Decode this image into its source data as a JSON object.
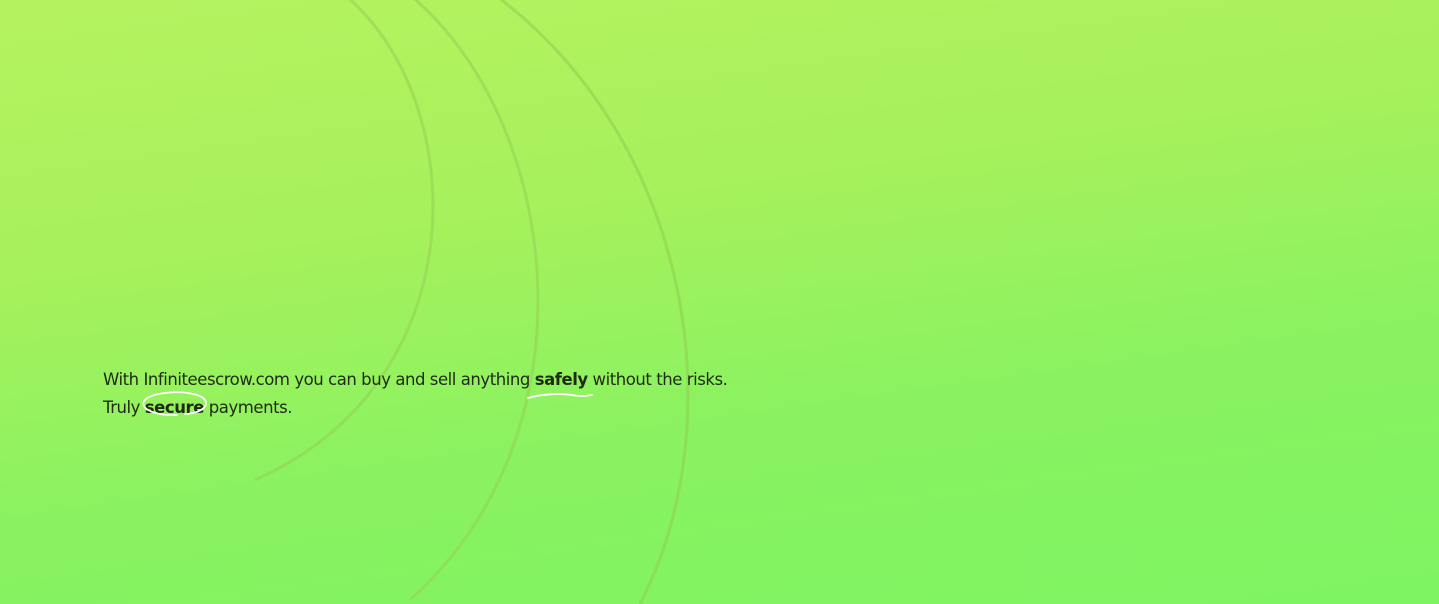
{
  "hero": {
    "line1_before": "With Infiniteescrow.com you can buy and sell anything ",
    "line1_highlight": "safely",
    "line1_after": " without the risks.",
    "line2_before": "Truly ",
    "line2_highlight": "secure",
    "line2_after": " payments."
  },
  "colors": {
    "background_top": "#b5f260",
    "background_bottom": "#7ef463",
    "text": "#1f2a14",
    "highlight_stroke": "#ffffff"
  }
}
